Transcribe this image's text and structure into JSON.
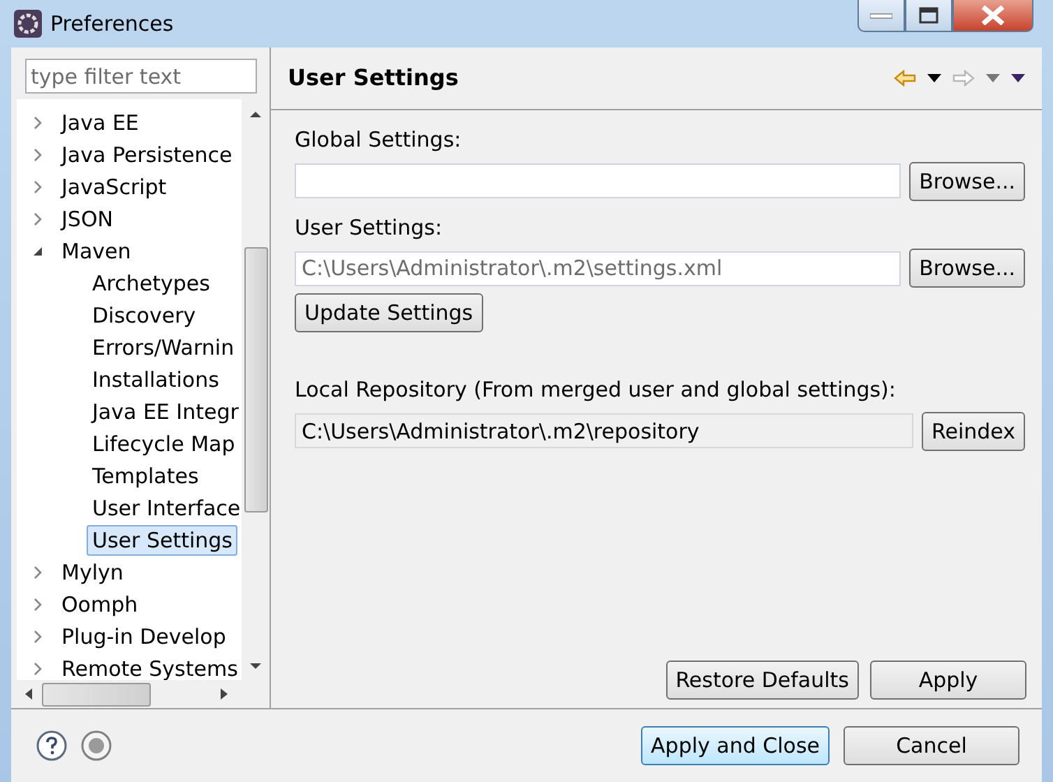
{
  "window": {
    "title": "Preferences"
  },
  "filter": {
    "placeholder": "type filter text"
  },
  "tree": [
    {
      "label": "Java EE",
      "expanded": false,
      "selected": false
    },
    {
      "label": "Java Persistence",
      "expanded": false,
      "selected": false
    },
    {
      "label": "JavaScript",
      "expanded": false,
      "selected": false
    },
    {
      "label": "JSON",
      "expanded": false,
      "selected": false
    },
    {
      "label": "Maven",
      "expanded": true,
      "selected": false,
      "children": [
        {
          "label": "Archetypes",
          "selected": false
        },
        {
          "label": "Discovery",
          "selected": false
        },
        {
          "label": "Errors/Warnin",
          "selected": false
        },
        {
          "label": "Installations",
          "selected": false
        },
        {
          "label": "Java EE Integr",
          "selected": false
        },
        {
          "label": "Lifecycle Map",
          "selected": false
        },
        {
          "label": "Templates",
          "selected": false
        },
        {
          "label": "User Interface",
          "selected": false
        },
        {
          "label": "User Settings",
          "selected": true
        }
      ]
    },
    {
      "label": "Mylyn",
      "expanded": false,
      "selected": false
    },
    {
      "label": "Oomph",
      "expanded": false,
      "selected": false
    },
    {
      "label": "Plug-in Develop",
      "expanded": false,
      "selected": false
    },
    {
      "label": "Remote Systems",
      "expanded": false,
      "selected": false
    }
  ],
  "page": {
    "title": "User Settings",
    "back_enabled": true,
    "forward_enabled": false,
    "global_settings": {
      "label": "Global Settings:",
      "button": "Browse..."
    },
    "user_settings": {
      "label": "User Settings:",
      "placeholder": "C:\\Users\\Administrator\\.m2\\settings.xml",
      "button": "Browse..."
    },
    "update_button": "Update Settings",
    "local_repository": {
      "label": "Local Repository (From merged user and global settings):",
      "value": "C:\\Users\\Administrator\\.m2\\repository",
      "readonly": true,
      "button": "Reindex"
    },
    "restore_button": "Restore Defaults",
    "apply_button": "Apply"
  },
  "footer": {
    "buttons": [
      {
        "label": "Apply and Close",
        "default": true
      },
      {
        "label": "Cancel",
        "default": false
      }
    ]
  }
}
